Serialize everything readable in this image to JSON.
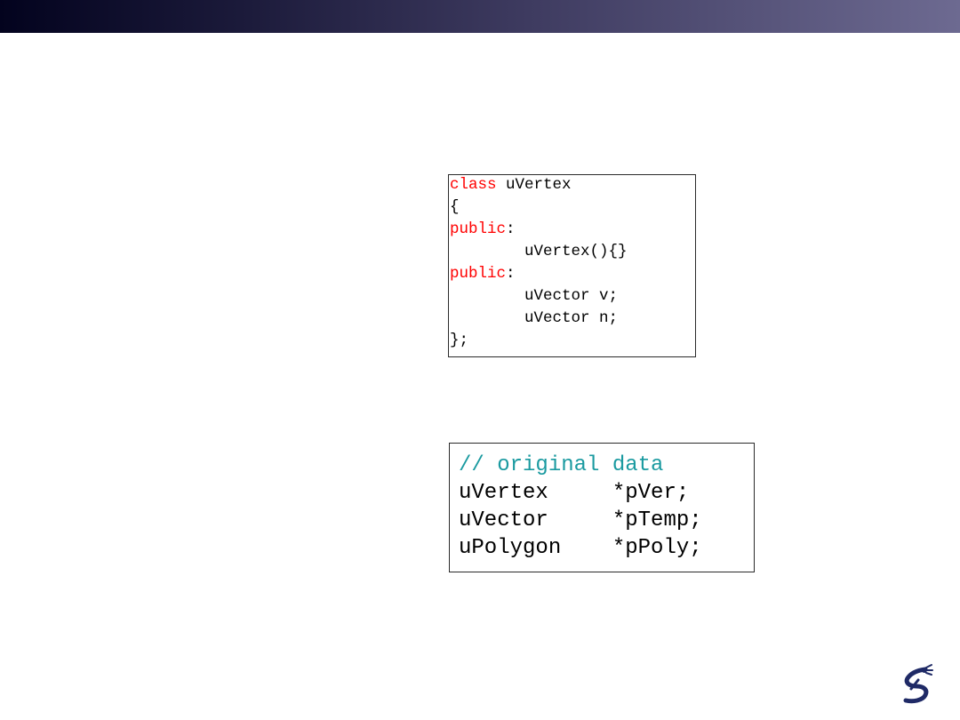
{
  "colors": {
    "keyword": "#ff0000",
    "comment": "#1a9aa0",
    "text": "#000000"
  },
  "code_block_1": {
    "lines": [
      [
        {
          "text": "class",
          "style": "keyword"
        },
        {
          "text": " uVertex",
          "style": "text"
        }
      ],
      [
        {
          "text": "{",
          "style": "text"
        }
      ],
      [
        {
          "text": "public",
          "style": "keyword"
        },
        {
          "text": ":",
          "style": "text"
        }
      ],
      [
        {
          "text": "        uVertex(){}",
          "style": "text"
        }
      ],
      [
        {
          "text": "public",
          "style": "keyword"
        },
        {
          "text": ":",
          "style": "text"
        }
      ],
      [
        {
          "text": "        uVector v;",
          "style": "text"
        }
      ],
      [
        {
          "text": "        uVector n;",
          "style": "text"
        }
      ],
      [
        {
          "text": "};",
          "style": "text"
        }
      ]
    ]
  },
  "code_block_2": {
    "lines": [
      [
        {
          "text": "// original data",
          "style": "comment"
        }
      ],
      [
        {
          "text": "uVertex     *pVer;",
          "style": "text"
        }
      ],
      [
        {
          "text": "uVector     *pTemp;",
          "style": "text"
        }
      ],
      [
        {
          "text": "uPolygon    *pPoly;",
          "style": "text"
        }
      ]
    ]
  },
  "logo": {
    "icon": "robot-arm-logo-icon"
  }
}
